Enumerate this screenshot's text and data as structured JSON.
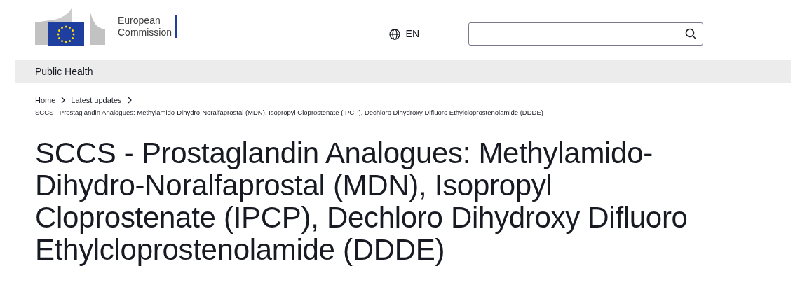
{
  "header": {
    "logo_text": [
      "European",
      "Commission"
    ],
    "language": "EN"
  },
  "site_bar": {
    "title": "Public Health"
  },
  "breadcrumb": {
    "links": [
      "Home",
      "Latest updates"
    ],
    "current": "SCCS - Prostaglandin Analogues: Methylamido-Dihydro-Noralfaprostal (MDN), Isopropyl Cloprostenate (IPCP), Dechloro Dihydroxy Difluoro Ethylcloprostenolamide (DDDE)"
  },
  "page_title": "SCCS - Prostaglandin Analogues: Methylamido-Dihydro-Noralfaprostal (MDN), Isopropyl Cloprostenate (IPCP), Dechloro Dihydroxy Difluoro Ethylcloprostenolamide (DDDE)"
}
